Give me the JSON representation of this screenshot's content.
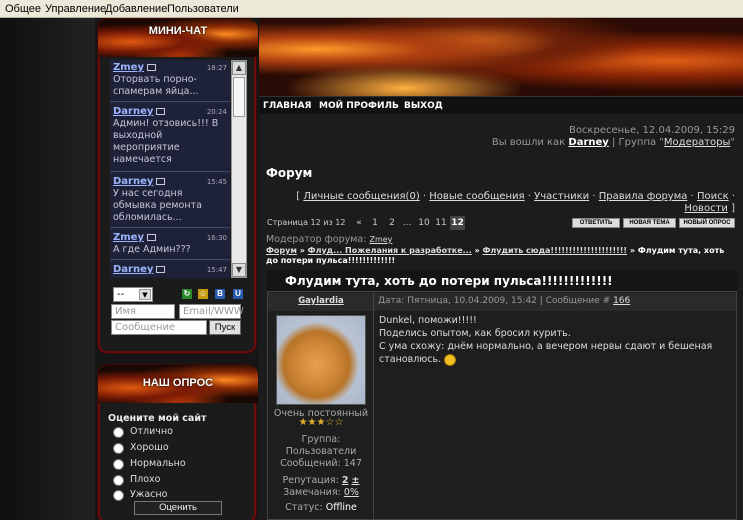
{
  "adminbar": {
    "items": [
      "Общее",
      "Управление",
      "Добавление",
      "Пользователи"
    ]
  },
  "chat": {
    "title": "МИНИ-ЧАТ",
    "messages": [
      {
        "user": "Zmey",
        "time": "18:27",
        "text": "Оторвать порно-спамерам яйца..."
      },
      {
        "user": "Darney",
        "time": "20:24",
        "text": "Админ! отзовись!!! В выходной мероприятие намечается"
      },
      {
        "user": "Darney",
        "time": "15:45",
        "text": "У нас сегодня обмывка ремонта обломилась..."
      },
      {
        "user": "Zmey",
        "time": "16:30",
        "text": "А где Админ???"
      },
      {
        "user": "Darney",
        "time": "15:47",
        "text": ""
      }
    ],
    "select_value": "--",
    "name_placeholder": "Имя",
    "email_placeholder": "Email/WWW",
    "message_placeholder": "Сообщение",
    "send_label": "Пуск",
    "icons": [
      {
        "name": "refresh-icon",
        "glyph": "↻",
        "color": "#2a8a2a"
      },
      {
        "name": "smiley-icon",
        "glyph": "☺",
        "color": "#c89a10"
      },
      {
        "name": "bbcode-b-icon",
        "glyph": "B",
        "color": "#2a5ab0"
      },
      {
        "name": "bbcode-u-icon",
        "glyph": "U",
        "color": "#2a5ab0"
      }
    ]
  },
  "poll": {
    "title": "НАШ ОПРОС",
    "question": "Оцените мой сайт",
    "options": [
      "Отлично",
      "Хорошо",
      "Нормально",
      "Плохо",
      "Ужасно"
    ],
    "vote_label": "Оценить"
  },
  "nav": {
    "items": [
      "ГЛАВНАЯ",
      "МОЙ ПРОФИЛЬ",
      "ВЫХОД"
    ]
  },
  "header": {
    "date": "Воскресенье, 12.04.2009, 15:29",
    "logged_prefix": "Вы вошли как",
    "username": "Darney",
    "group_prefix": "| Группа \"",
    "group": "Модераторы",
    "group_suffix": "\""
  },
  "forum": {
    "title": "Форум",
    "links": [
      "Личные сообщения(0)",
      "Новые сообщения",
      "Участники",
      "Правила форума",
      "Поиск",
      "Новости"
    ],
    "page_info": "Страница 12 из 12",
    "pages": [
      "«",
      "1",
      "2",
      "...",
      "10",
      "11",
      "12"
    ],
    "action_buttons": [
      "ОТВЕТИТЬ",
      "НОВАЯ ТЕМА",
      "НОВЫЙ ОПРОС"
    ],
    "moderator_label": "Модератор форума:",
    "moderator": "Zmey",
    "breadcrumb": [
      "Форум",
      "Флуд... Пожелания к разработке...",
      "Флудить сюда!!!!!!!!!!!!!!!!!!!!!"
    ],
    "topic": "Флудим тута, хоть до потери пульса!!!!!!!!!!!!!"
  },
  "post": {
    "author": "Gaylardia",
    "info": "Дата: Пятница, 10.04.2009, 15:42 | Сообщение #",
    "number": "166",
    "rank": "Очень постоянный",
    "stars": "★★★☆☆",
    "group_label": "Группа:",
    "group": "Пользователи",
    "posts": "Сообщений: 147",
    "rep_label": "Репутация:",
    "rep": "2",
    "rep_pm": "±",
    "warn_label": "Замечания:",
    "warn": "0%",
    "status_label": "Статус:",
    "status": "Offline",
    "lines": [
      "Dunkel, поможи!!!!!",
      "Поделись опытом, как бросил курить.",
      "С ума схожу: днём нормально, а вечером нервы сдают и бешеная",
      "становлюсь."
    ]
  },
  "colors": {
    "accent_red": "#6a0c0c",
    "link_blue": "#9db4ff",
    "flame": "#e05a10"
  }
}
